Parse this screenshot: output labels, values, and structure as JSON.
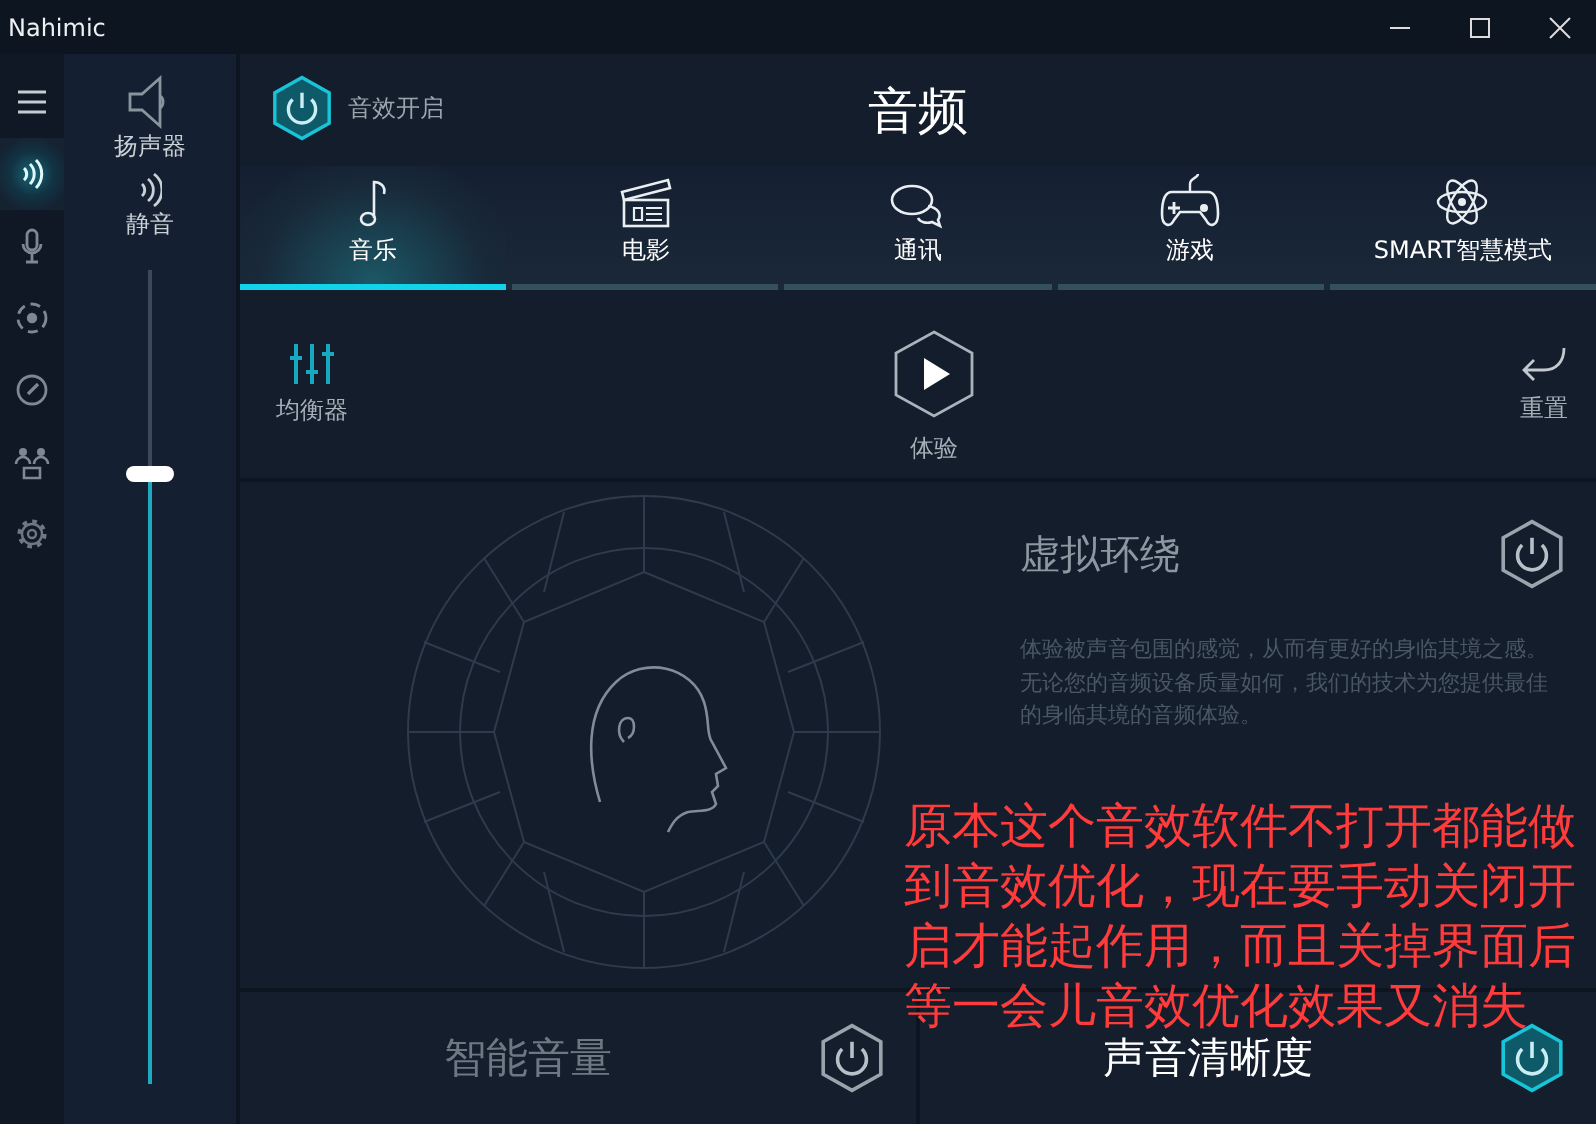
{
  "window": {
    "title": "Nahimic"
  },
  "nav": [
    {
      "kind": "menu",
      "selected": false
    },
    {
      "kind": "sound",
      "selected": true
    },
    {
      "kind": "mic",
      "selected": false
    },
    {
      "kind": "surround",
      "selected": false
    },
    {
      "kind": "gauge",
      "selected": false
    },
    {
      "kind": "people",
      "selected": false
    },
    {
      "kind": "settings",
      "selected": false
    }
  ],
  "volume": {
    "device": "扬声器",
    "mute": "静音",
    "level": 0.75
  },
  "header": {
    "power_label": "音效开启",
    "power_on": true,
    "title": "音频"
  },
  "tabs": [
    {
      "label": "音乐",
      "kind": "music",
      "selected": true
    },
    {
      "label": "电影",
      "kind": "movie",
      "selected": false
    },
    {
      "label": "通讯",
      "kind": "chat",
      "selected": false
    },
    {
      "label": "游戏",
      "kind": "game",
      "selected": false
    },
    {
      "label": "SMART智慧模式",
      "kind": "smart",
      "selected": false
    }
  ],
  "toolbar": {
    "equalizer": "均衡器",
    "play": "体验",
    "reset": "重置"
  },
  "surround": {
    "title": "虚拟环绕",
    "description": "体验被声音包围的感觉，从而有更好的身临其境之感。无论您的音频设备质量如何，我们的技术为您提供最佳的身临其境的音频体验。",
    "on": false
  },
  "features": [
    {
      "title": "智能音量",
      "on": false
    },
    {
      "title": "声音清晰度",
      "on": true
    }
  ],
  "annotation": "原本这个音效软件不打开都能做到音效优化，现在要手动关闭开启才能起作用，而且关掉界面后等一会儿音效优化效果又消失"
}
